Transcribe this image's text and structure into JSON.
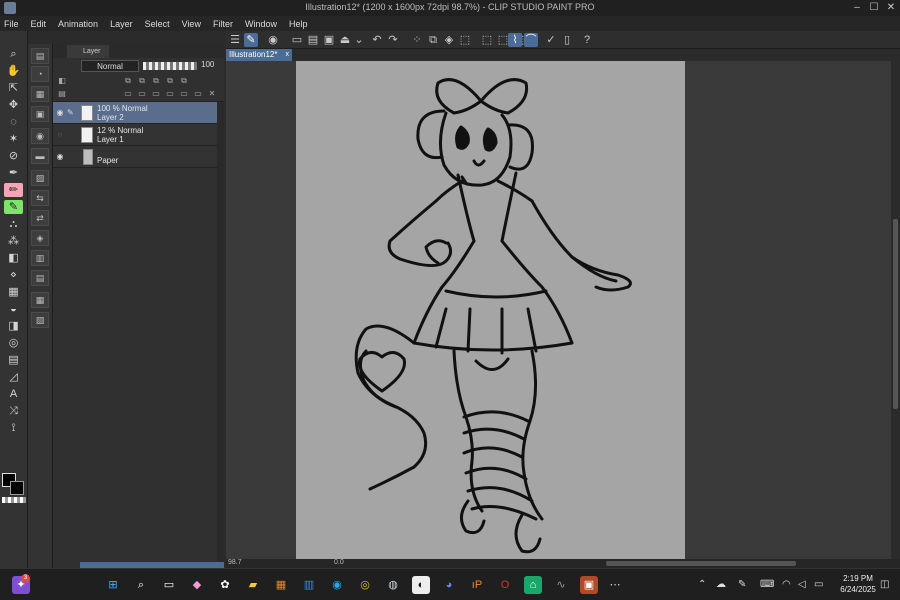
{
  "window": {
    "title": "Illustration12* (1200 x 1600px 72dpi 98.7%)  -  CLIP STUDIO PAINT PRO",
    "controls": [
      "–",
      "☐",
      "✕"
    ]
  },
  "menu": [
    "File",
    "Edit",
    "Animation",
    "Layer",
    "Select",
    "View",
    "Filter",
    "Window",
    "Help"
  ],
  "layer_panel": {
    "tab_label": "Layer",
    "blend_mode": "Normal",
    "opacity_value": "100",
    "layers": [
      {
        "line1": "100 % Normal",
        "line2": "Layer 2",
        "selected": true,
        "visible": true
      },
      {
        "line1": "12 % Normal",
        "line2": "Layer 1",
        "selected": false,
        "visible": false
      },
      {
        "line1": "",
        "line2": "Paper",
        "selected": false,
        "visible": true
      }
    ]
  },
  "canvas": {
    "tab_label": "Illustration12*",
    "tab_close": "x",
    "paper_color": "#a5a5a5"
  },
  "status": {
    "zoom": "98.7",
    "angle": "0.0"
  },
  "taskbar": {
    "badge": "3",
    "time": "2:19 PM",
    "date": "6/24/2025"
  },
  "colors": {
    "accent": "#4a6c96",
    "selected_tool": "#f2a6b8",
    "highlight_tool": "#7de36b",
    "main_color": "#000000"
  }
}
